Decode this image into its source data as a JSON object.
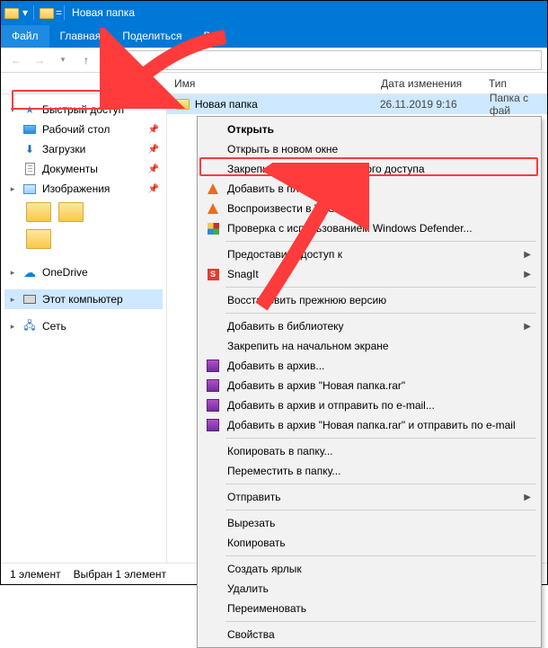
{
  "title": "Новая папка",
  "tabs": {
    "file": "Файл",
    "home": "Главная",
    "share": "Поделиться",
    "view": "Вид"
  },
  "cols": {
    "name": "Имя",
    "date": "Дата изменения",
    "type": "Тип"
  },
  "sidebar": {
    "quick": "Быстрый доступ",
    "desktop": "Рабочий стол",
    "downloads": "Загрузки",
    "documents": "Документы",
    "pictures": "Изображения",
    "onedrive": "OneDrive",
    "thispc": "Этот компьютер",
    "network": "Сеть"
  },
  "file": {
    "name": "Новая папка",
    "date": "26.11.2019 9:16",
    "type": "Папка с фай"
  },
  "status": {
    "count": "1 элемент",
    "sel": "Выбран 1 элемент"
  },
  "ctx": {
    "open": "Открыть",
    "open_new": "Открыть в новом окне",
    "pin_quick": "Закрепить на панели быстрого доступа",
    "vlc_add": "Добавить в плейлист VLC",
    "vlc_play": "Воспроизвести в VLC",
    "defender": "Проверка с использованием Windows Defender...",
    "share_access": "Предоставить доступ к",
    "snagit": "SnagIt",
    "restore": "Восстановить прежнюю версию",
    "library": "Добавить в библиотеку",
    "pin_start": "Закрепить на начальном экране",
    "rar_add": "Добавить в архив...",
    "rar_add_name": "Добавить в архив \"Новая папка.rar\"",
    "rar_mail": "Добавить в архив и отправить по e-mail...",
    "rar_mail_name": "Добавить в архив \"Новая папка.rar\" и отправить по e-mail",
    "copy_to": "Копировать в папку...",
    "move_to": "Переместить в папку...",
    "send_to": "Отправить",
    "cut": "Вырезать",
    "copy": "Копировать",
    "shortcut": "Создать ярлык",
    "delete": "Удалить",
    "rename": "Переименовать",
    "props": "Свойства"
  }
}
